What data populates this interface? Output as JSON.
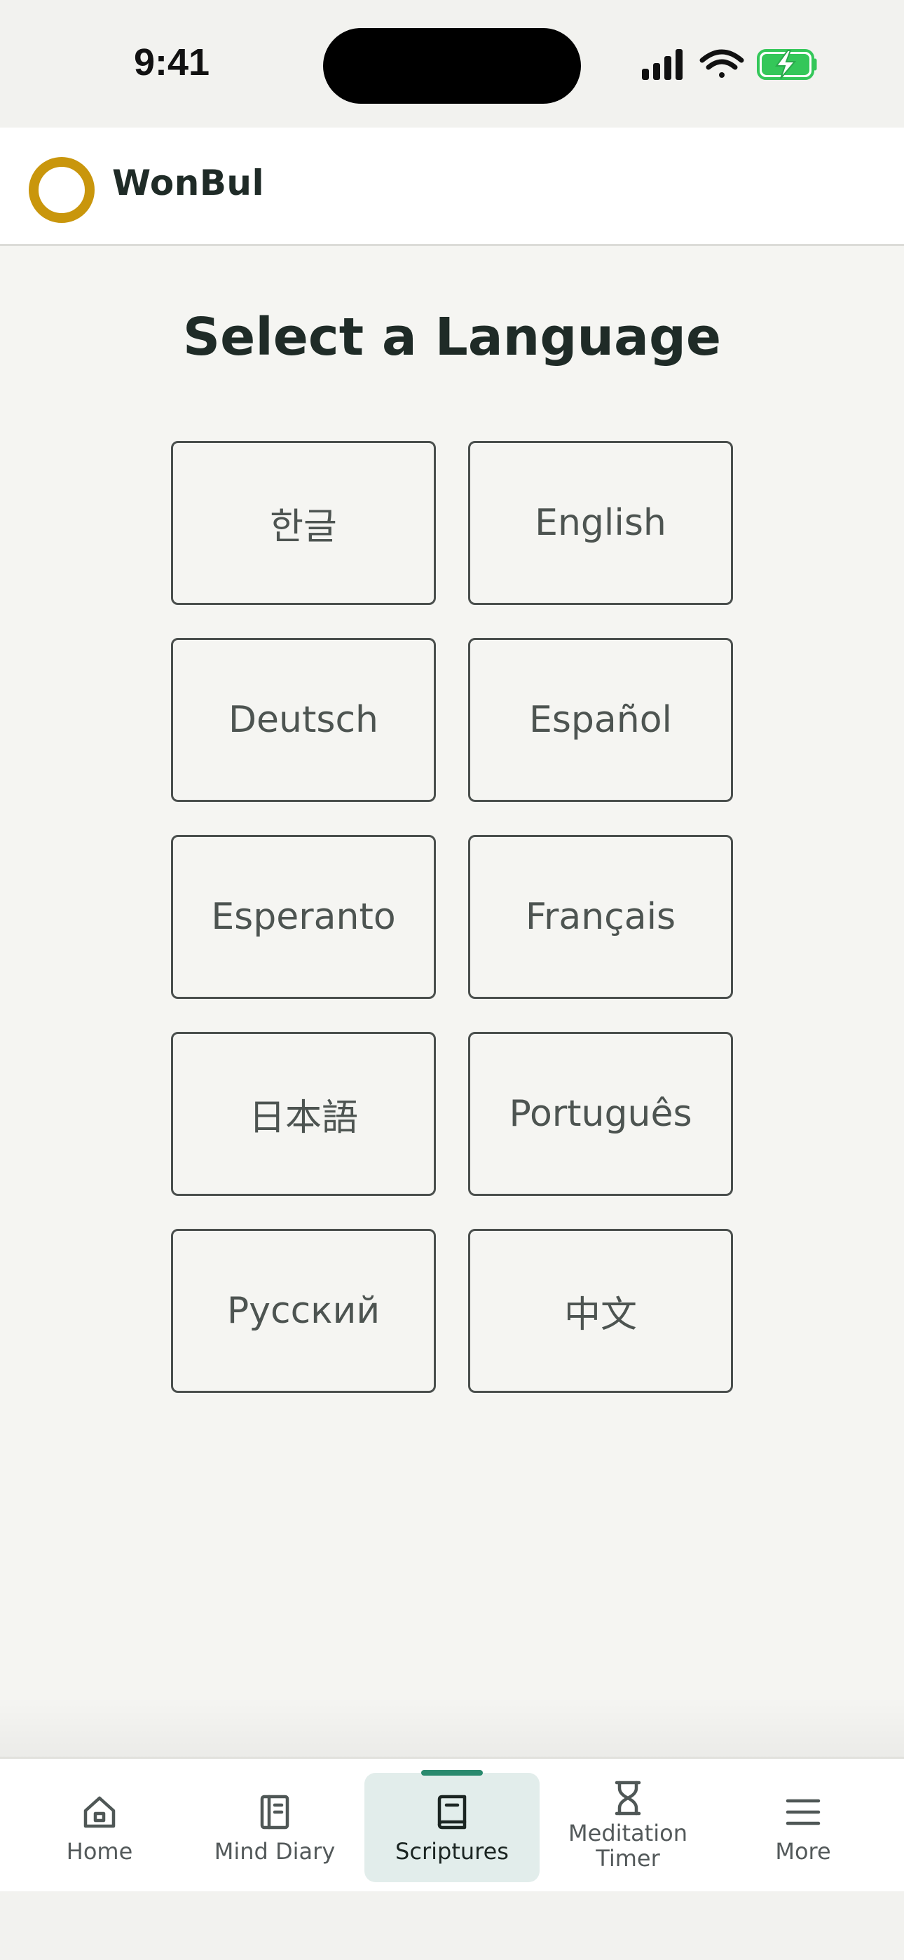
{
  "status_bar": {
    "time": "9:41"
  },
  "header": {
    "app_title": "WonBul",
    "logo_color": "#c9960c"
  },
  "main": {
    "title": "Select a Language",
    "languages": [
      {
        "label": "한글"
      },
      {
        "label": "English"
      },
      {
        "label": "Deutsch"
      },
      {
        "label": "Español"
      },
      {
        "label": "Esperanto"
      },
      {
        "label": "Français"
      },
      {
        "label": "日本語"
      },
      {
        "label": "Português"
      },
      {
        "label": "Русский"
      },
      {
        "label": "中文"
      }
    ]
  },
  "tab_bar": {
    "tabs": [
      {
        "label": "Home",
        "icon": "home-icon"
      },
      {
        "label": "Mind Diary",
        "icon": "notebook-icon"
      },
      {
        "label": "Scriptures",
        "icon": "book-icon",
        "active": true
      },
      {
        "label": "Meditation\nTimer",
        "icon": "hourglass-icon"
      },
      {
        "label": "More",
        "icon": "menu-icon"
      }
    ],
    "active_color": "#2a8a6e"
  }
}
